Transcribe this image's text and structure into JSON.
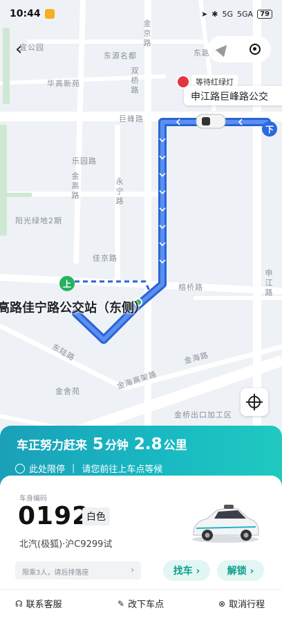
{
  "status": {
    "time": "10:44",
    "signal": "5G",
    "signal2": "5GA",
    "battery": "79"
  },
  "map": {
    "labels": {
      "park": "宜公园",
      "dongyuan": "东源名都",
      "huagao": "华高新苑",
      "shuangqiao": "双桥路",
      "jufeng": "巨峰路",
      "leyuan": "乐园路",
      "jingao": "金高路",
      "yongning": "永宁路",
      "yangguang": "阳光绿地2期",
      "jiajing": "佳京路",
      "rongqiao": "榕桥路",
      "shenjiang": "申江路",
      "dongyuanroad": "东陆路",
      "jinhai": "金海路",
      "jinhai_expressway": "金海高架路",
      "jinqiao_export": "金桥出口加工区",
      "jinshe": "金舍苑",
      "jinqiao_top": "金京路",
      "donglu_top": "东路高路"
    },
    "traffic_light_tag": "等待红绿灯",
    "destination_bubble": "申江路巨峰路公交",
    "pickup_label": "高路佳宁路公交站（东侧）",
    "dest_marker": "下",
    "pickup_marker": "上"
  },
  "panel": {
    "eta_prefix": "车正努力赶来",
    "eta_minutes": "5",
    "eta_min_unit": "分钟",
    "eta_distance": "2.8",
    "eta_dist_unit": "公里",
    "notice_left": "此处限停",
    "notice_sep": "|",
    "notice_right": "请您前往上车点等候"
  },
  "vehicle": {
    "id_label": "车身编码",
    "id": "0192",
    "color": "白色",
    "model": "北汽(极狐)·沪C9299试"
  },
  "actions": {
    "note_placeholder": "限乘3人，请后排落座",
    "find_car": "找车 ›",
    "unlock": "解锁 ›"
  },
  "bottom": {
    "service": "联系客服",
    "change_pickup": "改下车点",
    "cancel": "取消行程"
  }
}
